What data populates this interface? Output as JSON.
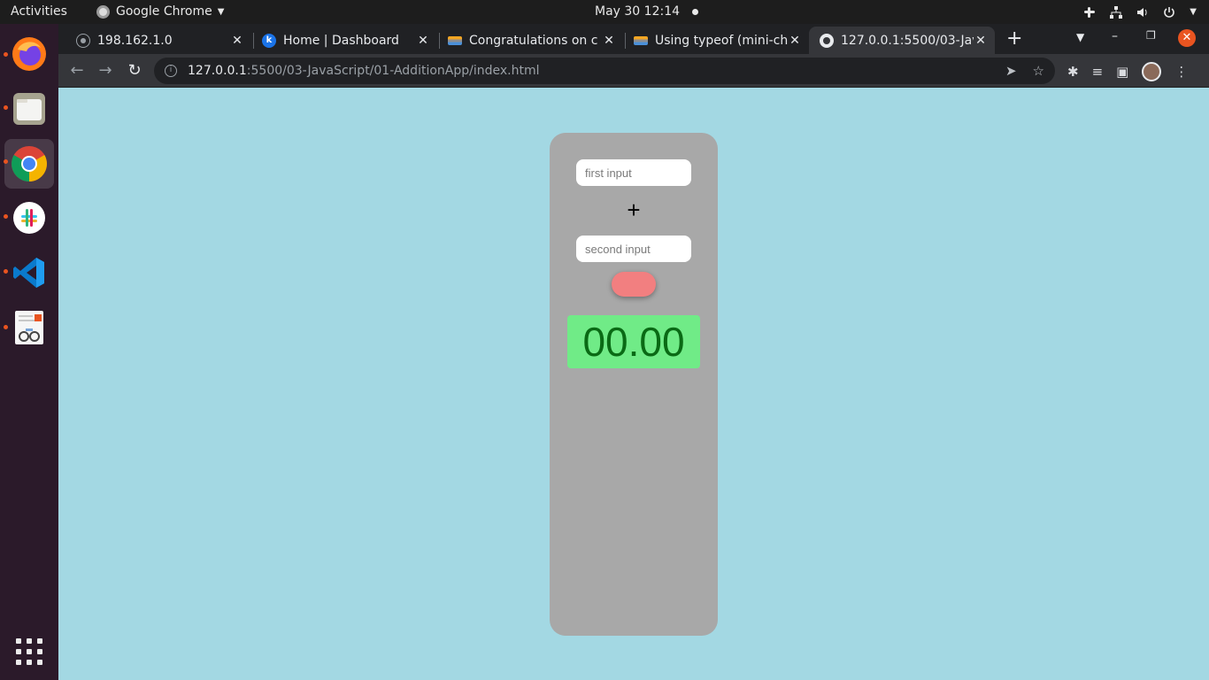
{
  "topbar": {
    "activities": "Activities",
    "app_name": "Google Chrome",
    "clock": "May 30  12:14"
  },
  "dock": {
    "items": [
      {
        "name": "Firefox",
        "icon": "firefox-icon"
      },
      {
        "name": "Files",
        "icon": "files-icon"
      },
      {
        "name": "Google Chrome",
        "icon": "chrome-icon"
      },
      {
        "name": "Slack",
        "icon": "slack-icon"
      },
      {
        "name": "Visual Studio Code",
        "icon": "vscode-icon"
      },
      {
        "name": "Document Viewer",
        "icon": "document-viewer-icon"
      }
    ]
  },
  "browser": {
    "tabs": [
      {
        "title": "198.162.1.0",
        "favicon": "globe-icon"
      },
      {
        "title": "Home | Dashboard",
        "favicon": "k-icon"
      },
      {
        "title": "Congratulations on c",
        "favicon": "dev-icon"
      },
      {
        "title": "Using typeof (mini-ch",
        "favicon": "dev-icon"
      },
      {
        "title": "127.0.0.1:5500/03-Jav",
        "favicon": "globe-icon",
        "active": true
      }
    ],
    "url_host": "127.0.0.1",
    "url_path": ":5500/03-JavaScript/01-AdditionApp/index.html"
  },
  "app": {
    "first_placeholder": "first input",
    "operator": "+",
    "second_placeholder": "second input",
    "result": "00.00"
  },
  "colors": {
    "page_bg": "#a3d8e3",
    "card_bg": "#a8a8a8",
    "button_bg": "#f27f80",
    "result_bg": "#70eb87",
    "result_text": "#0a6a15"
  }
}
